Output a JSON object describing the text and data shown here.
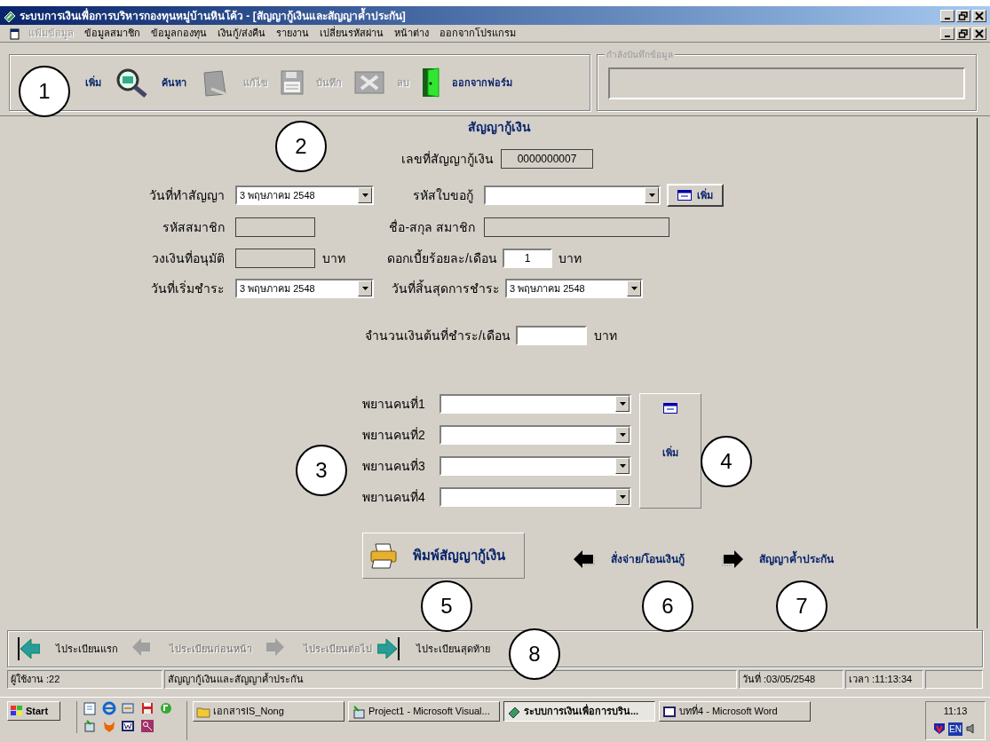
{
  "window": {
    "title": "ระบบการเงินเพื่อการบริหารกองทุนหมู่บ้านหินโค้ว - [สัญญากู้เงินและสัญญาค้ำประกัน]"
  },
  "menu": [
    {
      "label": "แฟ้มข้อมูล",
      "disabled": true
    },
    {
      "label": "ข้อมูลสมาชิก",
      "disabled": false
    },
    {
      "label": "ข้อมูลกองทุน",
      "disabled": false
    },
    {
      "label": "เงินกู้/ส่งคืน",
      "disabled": false
    },
    {
      "label": "รายงาน",
      "disabled": false
    },
    {
      "label": "เปลี่ยนรหัสผ่าน",
      "disabled": false
    },
    {
      "label": "หน้าต่าง",
      "disabled": false
    },
    {
      "label": "ออกจากโปรแกรม",
      "disabled": false
    }
  ],
  "toolbar": [
    {
      "label": "เพิ่ม",
      "kind": "add",
      "disabled": false
    },
    {
      "label": "ค้นหา",
      "kind": "search",
      "disabled": false
    },
    {
      "label": "แก้ไข",
      "kind": "edit",
      "disabled": true
    },
    {
      "label": "บันทึก",
      "kind": "save",
      "disabled": true
    },
    {
      "label": "ลบ",
      "kind": "delete",
      "disabled": true
    },
    {
      "label": "ออกจากฟอร์ม",
      "kind": "exit",
      "disabled": false
    }
  ],
  "saving_status": {
    "legend": "กำลังบันทึกข้อมูล"
  },
  "form": {
    "title": "สัญญากู้เงิน",
    "contract_no": {
      "label": "เลขที่สัญญากู้เงิน",
      "value": "0000000007"
    },
    "contract_date": {
      "label": "วันที่ทำสัญญา",
      "value": "3 พฤษภาคม 2548"
    },
    "application_code": {
      "label": "รหัสใบขอกู้"
    },
    "add_application_button": "เพิ่ม",
    "member_code": {
      "label": "รหัสสมาชิก",
      "disabled": true
    },
    "member_name": {
      "label": "ชื่อ-สกุล สมาชิก",
      "disabled": true
    },
    "approved_amount": {
      "label": "วงเงินที่อนุมัติ",
      "unit": "บาท",
      "disabled": true
    },
    "interest_rate": {
      "label": "ดอกเบี้ยร้อยละ/เดือน",
      "value": "1",
      "unit": "บาท",
      "disabled": false
    },
    "payment_start": {
      "label": "วันที่เริ่มชำระ",
      "value": "3 พฤษภาคม 2548"
    },
    "payment_end": {
      "label": "วันที่สิ้นสุดการชำระ",
      "value": "3 พฤษภาคม 2548"
    },
    "monthly_principal": {
      "label": "จำนวนเงินต้นที่ชำระ/เดือน",
      "unit": "บาท",
      "disabled": false
    },
    "witnesses": [
      {
        "label": "พยานคนที่1"
      },
      {
        "label": "พยานคนที่2"
      },
      {
        "label": "พยานคนที่3"
      },
      {
        "label": "พยานคนที่4"
      }
    ],
    "add_witness_button": "เพิ่ม",
    "print_button": "พิมพ์สัญญากู้เงิน",
    "links": [
      {
        "label": "สั่งจ่าย/โอนเงินกู้",
        "kind": "back"
      },
      {
        "label": "สัญญาค้ำประกัน",
        "kind": "forward"
      }
    ]
  },
  "record_nav": [
    {
      "label": "ไประเบียนแรก",
      "kind": "first",
      "disabled": false
    },
    {
      "label": "ไประเบียนก่อนหน้า",
      "kind": "previous",
      "disabled": true
    },
    {
      "label": "ไประเบียนต่อไป",
      "kind": "next",
      "disabled": true
    },
    {
      "label": "ไประเบียนสุดท้าย",
      "kind": "last",
      "disabled": false
    }
  ],
  "status_bar": [
    "ผู้ใช้งาน :22",
    "สัญญากู้เงินและสัญญาค้ำประกัน",
    "วันที่ :03/05/2548",
    "เวลา :11:13:34"
  ],
  "taskbar": {
    "start": "Start",
    "tasks": [
      {
        "label": "เอกสารIS_Nong",
        "kind": "folder",
        "selected": false
      },
      {
        "label": "Project1 - Microsoft Visual...",
        "kind": "vb",
        "selected": false
      },
      {
        "label": "ระบบการเงินเพื่อการบริน...",
        "kind": "app",
        "selected": true
      },
      {
        "label": "บทที่4 - Microsoft Word",
        "kind": "word",
        "selected": false
      }
    ],
    "clock": "11:13",
    "language": "EN"
  },
  "callouts": [
    "1",
    "2",
    "3",
    "4",
    "5",
    "6",
    "7",
    "8"
  ]
}
